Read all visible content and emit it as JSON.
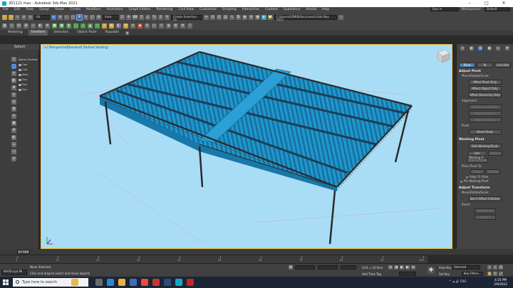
{
  "window": {
    "title": "301121.max - Autodesk 3ds Max 2021",
    "controls": [
      "–",
      "□",
      "✕"
    ]
  },
  "menubar": {
    "items": [
      "File",
      "Edit",
      "Tools",
      "Group",
      "Views",
      "Create",
      "Modifiers",
      "Animation",
      "Graph Editors",
      "Rendering",
      "Civil View",
      "Customize",
      "Scripting",
      "Interactive",
      "Content",
      "Substance",
      "Arnold",
      "Help"
    ],
    "sign_in": "Sign In",
    "workspaces_label": "Workspaces:",
    "workspace_value": "Default"
  },
  "toolbar": {
    "filter_value": "All",
    "view_value": "View",
    "selection_set": "Create Selection Se",
    "path_field": "C:\\Users\\ADMIN\\Documents\\3ds Max 2021"
  },
  "ribbon": {
    "tabs": [
      "Modeling",
      "Freeform",
      "Selection",
      "Object Paint",
      "Populate"
    ],
    "selected": "Freeform"
  },
  "scene_explorer": {
    "header": "Select",
    "column_header": "Name (Sorted ...",
    "items": [
      "Can",
      "Can",
      "dem",
      "Gra",
      "Gra",
      "Gra"
    ],
    "layer_field": "0"
  },
  "viewport": {
    "label_left": "[+] [Perspective]",
    "label_right": "[Standard] [Default Shading]",
    "background_color": "#a9ddf6",
    "roof_color": "#1e9ad1",
    "truss_color": "#2a2a2a"
  },
  "command_panel": {
    "segments": [
      "Pivot",
      "IK",
      "Link Info"
    ],
    "selected_segment": "Pivot",
    "adjust_pivot": {
      "title": "Adjust Pivot",
      "move_label": "Move/Rotate/Scale:",
      "buttons": [
        "Affect Pivot Only",
        "Affect Object Only",
        "Affect Hierarchy Only"
      ],
      "alignment_label": "Alignment:",
      "alignment_buttons": [
        "Center to Object",
        "Align to Object",
        "Align to World"
      ],
      "pivot_label": "Pivot:",
      "reset_button": "Reset Pivot"
    },
    "working_pivot": {
      "title": "Working Pivot",
      "edit_button": "Edit Working Pivot",
      "use_button": "Use Working P...",
      "align_button": "Align To View",
      "reset_button": "Reset",
      "place_label": "Place Pivot To:",
      "view_button": "View",
      "surface_button": "Surface",
      "align_check": "Align To View",
      "pin_check": "Pin Working Pivot"
    },
    "adjust_transform": {
      "title": "Adjust Transform",
      "move_label": "Move/Rotate/Scale:",
      "dont_affect": "Don't Affect Children",
      "reset_label": "Reset:",
      "reset_buttons": [
        "Transform",
        "Scale"
      ]
    }
  },
  "timeline": {
    "slider": "0 / 100",
    "ticks": [
      "0",
      "10",
      "20",
      "30",
      "40",
      "50",
      "60",
      "70",
      "80",
      "90",
      "100"
    ]
  },
  "status": {
    "selection": "None Selected",
    "prompt": "Click and drag to select and move objects",
    "maxscript": "MAXScript Mi",
    "grid": "Grid = 10.0cm",
    "add_time_tag": "Add Time Tag",
    "auto_label": "Auto Key",
    "selected_value": "Selected",
    "set_key": "Set Key",
    "key_filters": "Key Filters..."
  },
  "taskbar": {
    "search_placeholder": "Type here to search",
    "time": "4:25 PM",
    "date": "2/9/2022",
    "tray": "^ ☁ 🔊 ENG"
  }
}
